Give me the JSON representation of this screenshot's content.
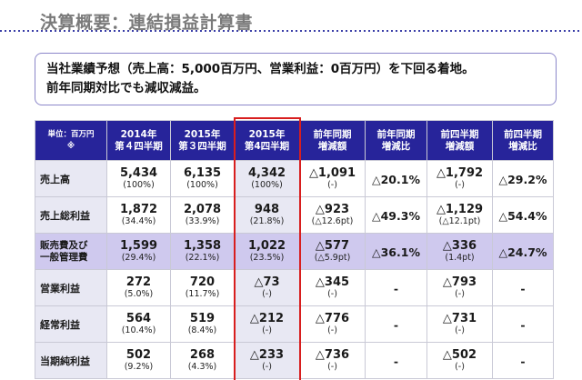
{
  "title": "決算概要：連結損益計算書",
  "summary": {
    "line1": "当社業績予想（売上高：5,000百万円、営業利益：0百万円）を下回る着地。",
    "line2": "前年同期対比でも減収減益。"
  },
  "table": {
    "corner": [
      "単位：百万円",
      "※"
    ],
    "headers": [
      [
        "2014年",
        "第４四半期"
      ],
      [
        "2015年",
        "第３四半期"
      ],
      [
        "2015年",
        "第4四半期"
      ],
      [
        "前年同期",
        "増減額"
      ],
      [
        "前年同期",
        "増減比"
      ],
      [
        "前四半期",
        "増減額"
      ],
      [
        "前四半期",
        "増減比"
      ]
    ],
    "rows": [
      {
        "label": [
          "売上高"
        ],
        "cells": [
          {
            "main": "5,434",
            "sub": "(100%)"
          },
          {
            "main": "6,135",
            "sub": "(100%)"
          },
          {
            "main": "4,342",
            "sub": "(100%)"
          },
          {
            "main": "△1,091",
            "sub": "(-)"
          },
          {
            "single": "△20.1%"
          },
          {
            "main": "△1,792",
            "sub": "(-)"
          },
          {
            "single": "△29.2%"
          }
        ]
      },
      {
        "label": [
          "売上総利益"
        ],
        "cells": [
          {
            "main": "1,872",
            "sub": "(34.4%)"
          },
          {
            "main": "2,078",
            "sub": "(33.9%)"
          },
          {
            "main": "948",
            "sub": "(21.8%)"
          },
          {
            "main": "△923",
            "sub": "(△12.6pt)"
          },
          {
            "single": "△49.3%"
          },
          {
            "main": "△1,129",
            "sub": "(△12.1pt)"
          },
          {
            "single": "△54.4%"
          }
        ]
      },
      {
        "label": [
          "販売費及び",
          "一般管理費"
        ],
        "highlight": true,
        "cells": [
          {
            "main": "1,599",
            "sub": "(29.4%)"
          },
          {
            "main": "1,358",
            "sub": "(22.1%)"
          },
          {
            "main": "1,022",
            "sub": "(23.5%)"
          },
          {
            "main": "△577",
            "sub": "(△5.9pt)"
          },
          {
            "single": "△36.1%"
          },
          {
            "main": "△336",
            "sub": "(1.4pt)"
          },
          {
            "single": "△24.7%"
          }
        ]
      },
      {
        "label": [
          "営業利益"
        ],
        "cells": [
          {
            "main": "272",
            "sub": "(5.0%)"
          },
          {
            "main": "720",
            "sub": "(11.7%)"
          },
          {
            "main": "△73",
            "sub": "(-)"
          },
          {
            "main": "△345",
            "sub": "(-)"
          },
          {
            "single": "-"
          },
          {
            "main": "△793",
            "sub": "(-)"
          },
          {
            "single": "-"
          }
        ]
      },
      {
        "label": [
          "経常利益"
        ],
        "cells": [
          {
            "main": "564",
            "sub": "(10.4%)"
          },
          {
            "main": "519",
            "sub": "(8.4%)"
          },
          {
            "main": "△212",
            "sub": "(-)"
          },
          {
            "main": "△776",
            "sub": "(-)"
          },
          {
            "single": "-"
          },
          {
            "main": "△731",
            "sub": "(-)"
          },
          {
            "single": "-"
          }
        ]
      },
      {
        "label": [
          "当期純利益"
        ],
        "cells": [
          {
            "main": "502",
            "sub": "(9.2%)"
          },
          {
            "main": "268",
            "sub": "(4.3%)"
          },
          {
            "main": "△233",
            "sub": "(-)"
          },
          {
            "main": "△736",
            "sub": "(-)"
          },
          {
            "single": "-"
          },
          {
            "main": "△502",
            "sub": "(-)"
          },
          {
            "single": "-"
          }
        ]
      }
    ]
  }
}
